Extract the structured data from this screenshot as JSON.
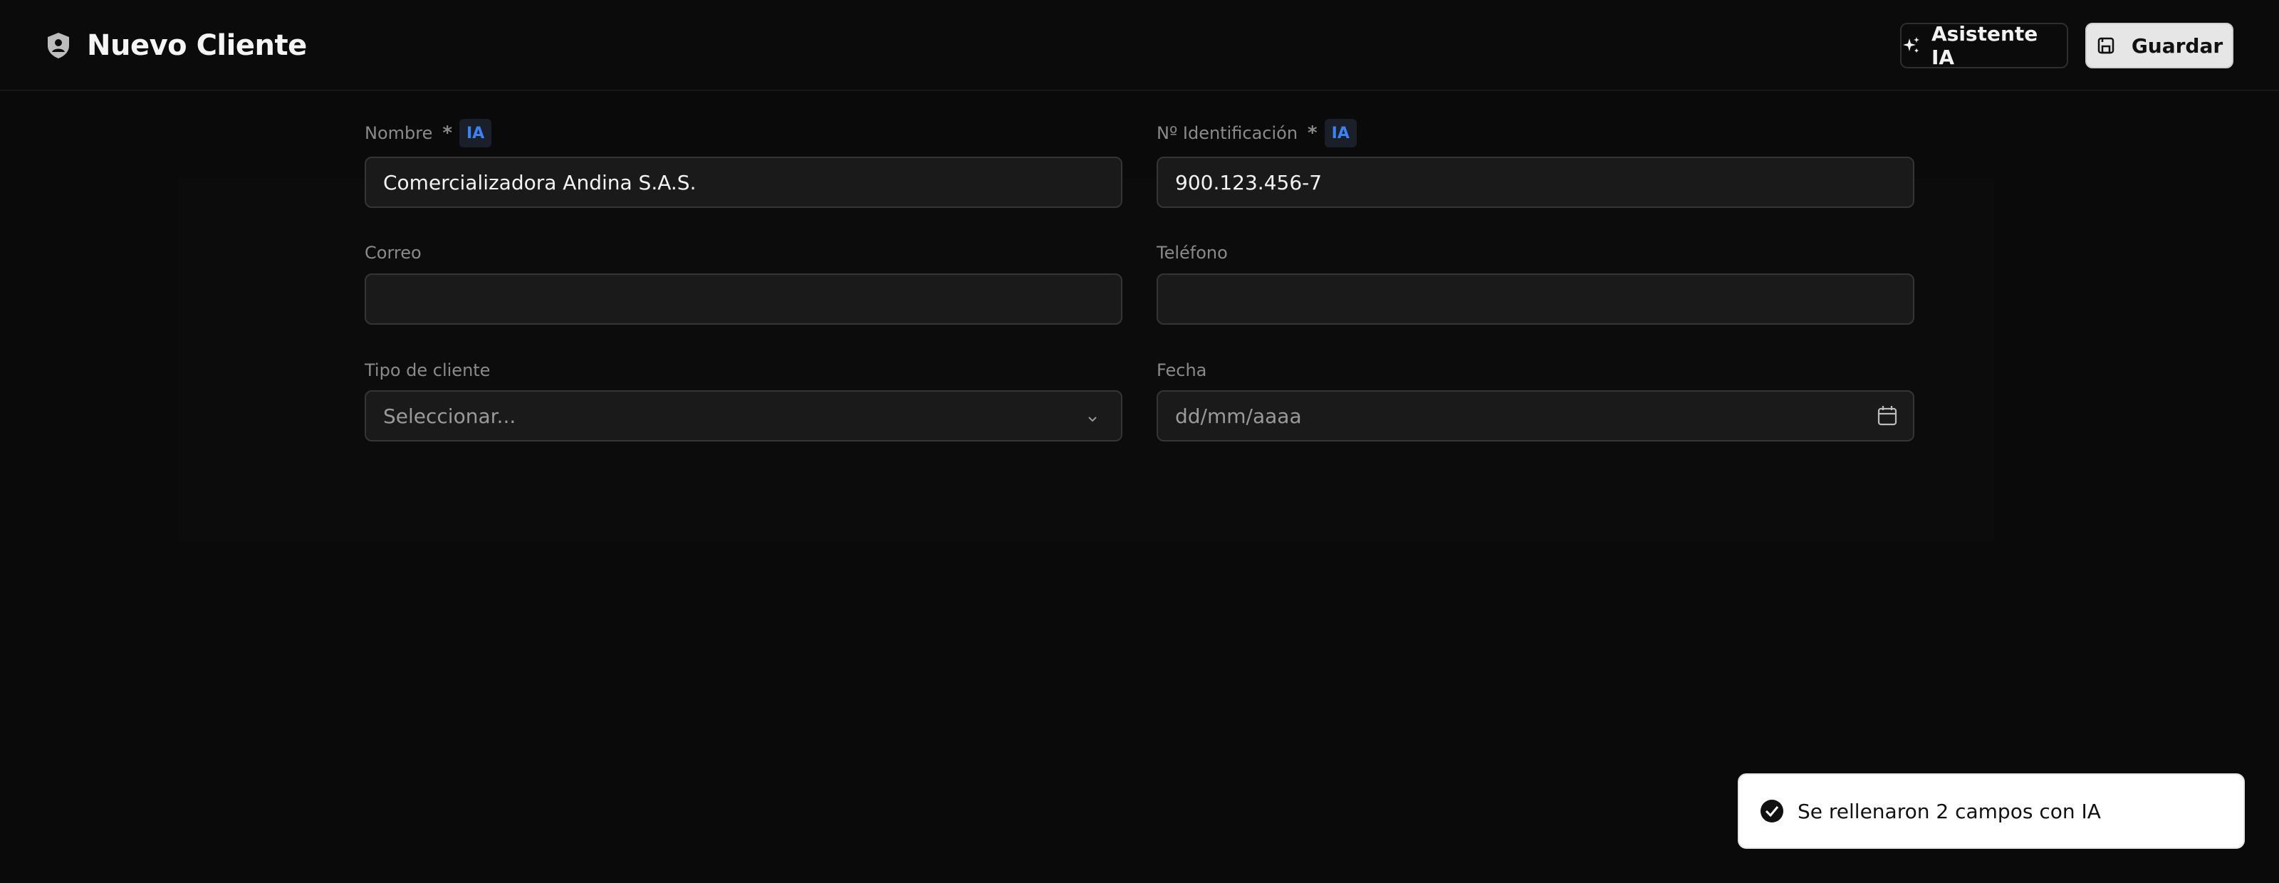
{
  "header": {
    "title": "Nuevo Cliente",
    "brand_icon": "shield-user-icon",
    "ai_button_label": "Asistente IA",
    "save_button_label": "Guardar"
  },
  "form": {
    "ia_badge": "IA",
    "required_mark": "*",
    "fields": {
      "nombre": {
        "label": "Nombre",
        "value": "Comercializadora Andina S.A.S."
      },
      "identificacion": {
        "label": "Nº Identificación",
        "value": "900.123.456-7"
      },
      "correo": {
        "label": "Correo",
        "value": ""
      },
      "telefono": {
        "label": "Teléfono",
        "value": ""
      },
      "tipo_cliente": {
        "label": "Tipo de cliente",
        "selected": "Seleccionar..."
      },
      "fecha": {
        "label": "Fecha",
        "placeholder": "dd/mm/aaaa"
      }
    }
  },
  "toast": {
    "message": "Se rellenaron 2 campos con IA",
    "icon": "check-circle-icon"
  },
  "colors": {
    "background": "#0a0a0a",
    "input_bg": "#1a1a1a",
    "accent_blue": "#3b82f6",
    "save_button_bg": "#e6e6e6"
  }
}
